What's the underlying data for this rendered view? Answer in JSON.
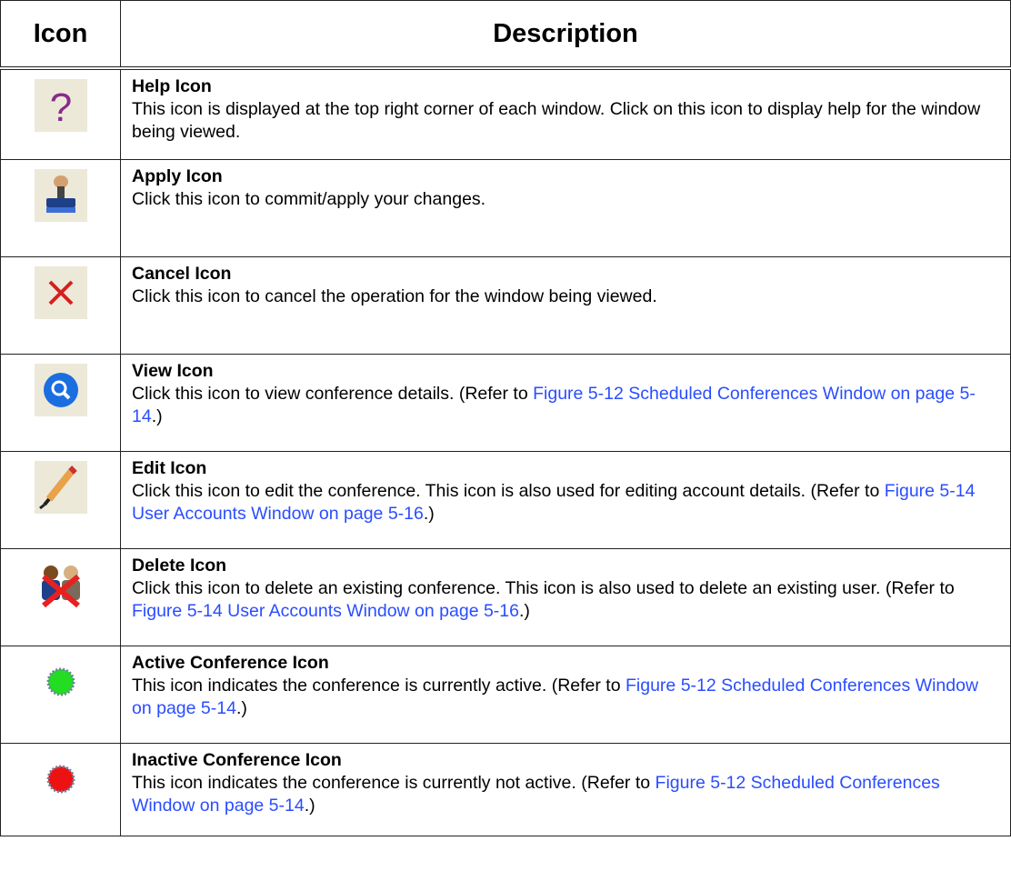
{
  "header": {
    "icon_col": "Icon",
    "description_col": "Description"
  },
  "rows": [
    {
      "icon": "help-icon",
      "name": "Help Icon",
      "text": "This icon is displayed at the top right corner of  each window.  Click on this icon to display help for the window being viewed."
    },
    {
      "icon": "apply-icon",
      "name": "Apply Icon",
      "text": "Click this icon to commit/apply your changes."
    },
    {
      "icon": "cancel-icon",
      "name": "Cancel Icon",
      "text": "Click this icon to cancel the operation for the window being viewed."
    },
    {
      "icon": "view-icon",
      "name": "View Icon",
      "text_before": "Click this icon to view conference details. (Refer to ",
      "link": "Figure 5-12 Scheduled Conferences Window on page 5-14",
      "text_after": ".)"
    },
    {
      "icon": "edit-icon",
      "name": "Edit Icon",
      "text_before": "Click this icon to edit the conference. This icon is also used for editing account details. (Refer to ",
      "link": "Figure 5-14 User Accounts Window on page 5-16",
      "text_after": ".)"
    },
    {
      "icon": "delete-icon",
      "name": "Delete Icon",
      "text_before": "Click this icon to delete an existing conference. This icon is also used to delete an existing user. (Refer to ",
      "link": "Figure 5-14 User Accounts Window on page 5-16",
      "text_after": ".)"
    },
    {
      "icon": "active-conference-icon",
      "name": "Active Conference Icon",
      "text_before": "This icon indicates the conference is currently active. (Refer to ",
      "link": "Figure 5-12 Scheduled Conferences Window on page 5-14",
      "text_after": ".)"
    },
    {
      "icon": "inactive-conference-icon",
      "name": "Inactive Conference Icon",
      "text_before": "This icon indicates the conference is currently not active.   (Refer to ",
      "link": "Figure 5-12 Scheduled Conferences Window on page 5-14",
      "text_after": ".)"
    }
  ],
  "colors": {
    "link": "#2a4dff",
    "icon_bg": "#ece9d8",
    "active": "#22dd22",
    "inactive": "#ee1111"
  }
}
